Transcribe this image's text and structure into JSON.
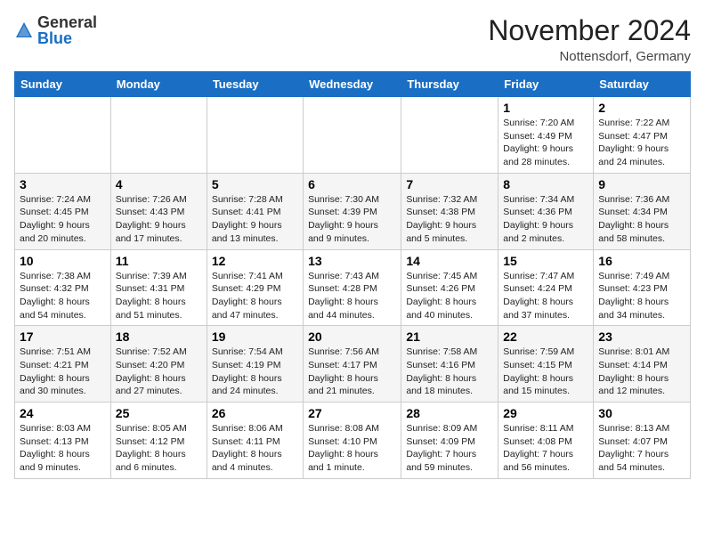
{
  "header": {
    "logo_general": "General",
    "logo_blue": "Blue",
    "month": "November 2024",
    "location": "Nottensdorf, Germany"
  },
  "weekdays": [
    "Sunday",
    "Monday",
    "Tuesday",
    "Wednesday",
    "Thursday",
    "Friday",
    "Saturday"
  ],
  "weeks": [
    [
      {
        "day": "",
        "info": ""
      },
      {
        "day": "",
        "info": ""
      },
      {
        "day": "",
        "info": ""
      },
      {
        "day": "",
        "info": ""
      },
      {
        "day": "",
        "info": ""
      },
      {
        "day": "1",
        "info": "Sunrise: 7:20 AM\nSunset: 4:49 PM\nDaylight: 9 hours\nand 28 minutes."
      },
      {
        "day": "2",
        "info": "Sunrise: 7:22 AM\nSunset: 4:47 PM\nDaylight: 9 hours\nand 24 minutes."
      }
    ],
    [
      {
        "day": "3",
        "info": "Sunrise: 7:24 AM\nSunset: 4:45 PM\nDaylight: 9 hours\nand 20 minutes."
      },
      {
        "day": "4",
        "info": "Sunrise: 7:26 AM\nSunset: 4:43 PM\nDaylight: 9 hours\nand 17 minutes."
      },
      {
        "day": "5",
        "info": "Sunrise: 7:28 AM\nSunset: 4:41 PM\nDaylight: 9 hours\nand 13 minutes."
      },
      {
        "day": "6",
        "info": "Sunrise: 7:30 AM\nSunset: 4:39 PM\nDaylight: 9 hours\nand 9 minutes."
      },
      {
        "day": "7",
        "info": "Sunrise: 7:32 AM\nSunset: 4:38 PM\nDaylight: 9 hours\nand 5 minutes."
      },
      {
        "day": "8",
        "info": "Sunrise: 7:34 AM\nSunset: 4:36 PM\nDaylight: 9 hours\nand 2 minutes."
      },
      {
        "day": "9",
        "info": "Sunrise: 7:36 AM\nSunset: 4:34 PM\nDaylight: 8 hours\nand 58 minutes."
      }
    ],
    [
      {
        "day": "10",
        "info": "Sunrise: 7:38 AM\nSunset: 4:32 PM\nDaylight: 8 hours\nand 54 minutes."
      },
      {
        "day": "11",
        "info": "Sunrise: 7:39 AM\nSunset: 4:31 PM\nDaylight: 8 hours\nand 51 minutes."
      },
      {
        "day": "12",
        "info": "Sunrise: 7:41 AM\nSunset: 4:29 PM\nDaylight: 8 hours\nand 47 minutes."
      },
      {
        "day": "13",
        "info": "Sunrise: 7:43 AM\nSunset: 4:28 PM\nDaylight: 8 hours\nand 44 minutes."
      },
      {
        "day": "14",
        "info": "Sunrise: 7:45 AM\nSunset: 4:26 PM\nDaylight: 8 hours\nand 40 minutes."
      },
      {
        "day": "15",
        "info": "Sunrise: 7:47 AM\nSunset: 4:24 PM\nDaylight: 8 hours\nand 37 minutes."
      },
      {
        "day": "16",
        "info": "Sunrise: 7:49 AM\nSunset: 4:23 PM\nDaylight: 8 hours\nand 34 minutes."
      }
    ],
    [
      {
        "day": "17",
        "info": "Sunrise: 7:51 AM\nSunset: 4:21 PM\nDaylight: 8 hours\nand 30 minutes."
      },
      {
        "day": "18",
        "info": "Sunrise: 7:52 AM\nSunset: 4:20 PM\nDaylight: 8 hours\nand 27 minutes."
      },
      {
        "day": "19",
        "info": "Sunrise: 7:54 AM\nSunset: 4:19 PM\nDaylight: 8 hours\nand 24 minutes."
      },
      {
        "day": "20",
        "info": "Sunrise: 7:56 AM\nSunset: 4:17 PM\nDaylight: 8 hours\nand 21 minutes."
      },
      {
        "day": "21",
        "info": "Sunrise: 7:58 AM\nSunset: 4:16 PM\nDaylight: 8 hours\nand 18 minutes."
      },
      {
        "day": "22",
        "info": "Sunrise: 7:59 AM\nSunset: 4:15 PM\nDaylight: 8 hours\nand 15 minutes."
      },
      {
        "day": "23",
        "info": "Sunrise: 8:01 AM\nSunset: 4:14 PM\nDaylight: 8 hours\nand 12 minutes."
      }
    ],
    [
      {
        "day": "24",
        "info": "Sunrise: 8:03 AM\nSunset: 4:13 PM\nDaylight: 8 hours\nand 9 minutes."
      },
      {
        "day": "25",
        "info": "Sunrise: 8:05 AM\nSunset: 4:12 PM\nDaylight: 8 hours\nand 6 minutes."
      },
      {
        "day": "26",
        "info": "Sunrise: 8:06 AM\nSunset: 4:11 PM\nDaylight: 8 hours\nand 4 minutes."
      },
      {
        "day": "27",
        "info": "Sunrise: 8:08 AM\nSunset: 4:10 PM\nDaylight: 8 hours\nand 1 minute."
      },
      {
        "day": "28",
        "info": "Sunrise: 8:09 AM\nSunset: 4:09 PM\nDaylight: 7 hours\nand 59 minutes."
      },
      {
        "day": "29",
        "info": "Sunrise: 8:11 AM\nSunset: 4:08 PM\nDaylight: 7 hours\nand 56 minutes."
      },
      {
        "day": "30",
        "info": "Sunrise: 8:13 AM\nSunset: 4:07 PM\nDaylight: 7 hours\nand 54 minutes."
      }
    ]
  ]
}
